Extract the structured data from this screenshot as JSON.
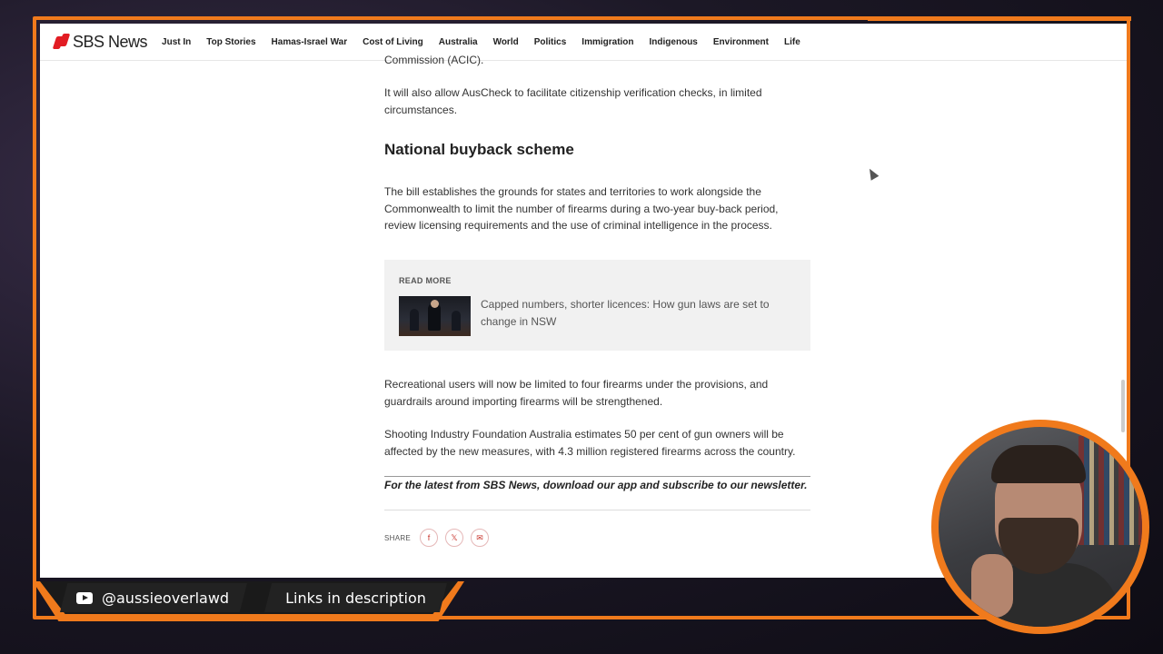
{
  "nav": {
    "logo_text": "SBS News",
    "items": [
      "Just In",
      "Top Stories",
      "Hamas-Israel War",
      "Cost of Living",
      "Australia",
      "World",
      "Politics",
      "Immigration",
      "Indigenous",
      "Environment",
      "Life"
    ]
  },
  "article": {
    "p0": "Commission (ACIC).",
    "p1": "It will also allow AusCheck to facilitate citizenship verification checks, in limited circumstances.",
    "heading": "National buyback scheme",
    "p2": "The bill establishes the grounds for states and territories to work alongside the Commonwealth to limit the number of firearms during a two-year buy-back period, review licensing requirements and the use of criminal intelligence in the process.",
    "read_more": {
      "label": "READ MORE",
      "title": "Capped numbers, shorter licences: How gun laws are set to change in NSW"
    },
    "p3": "Recreational users will now be limited to four firearms under the provisions, and guardrails around importing firearms will be strengthened.",
    "p4": "Shooting Industry Foundation Australia estimates 50 per cent of gun owners will be affected by the new measures, with 4.3 million registered firearms across the country.",
    "footer_note": "For the latest from SBS News, download our app and subscribe to our newsletter.",
    "share_label": "SHARE",
    "share_icons": [
      "facebook-icon",
      "x-icon",
      "email-icon"
    ]
  },
  "overlay": {
    "handle": "@aussieoverlawd",
    "links": "Links in description"
  },
  "colors": {
    "accent": "#f07a1c",
    "brand_red": "#e21c23"
  }
}
